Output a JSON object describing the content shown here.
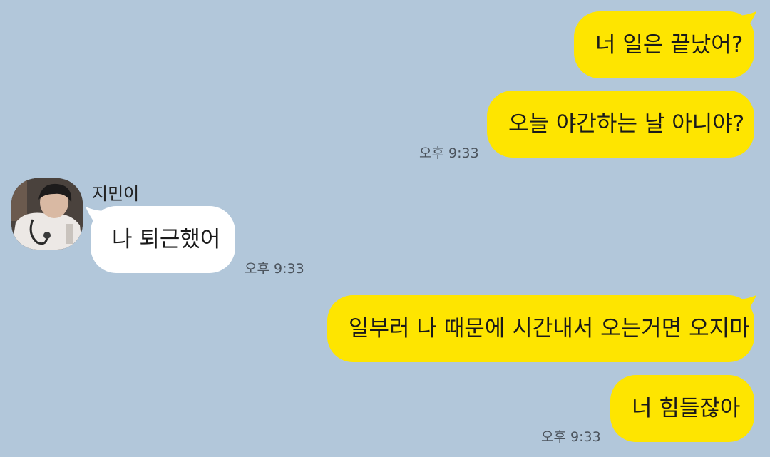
{
  "chat": {
    "sender_name": "지민이",
    "messages": [
      {
        "from": "me",
        "text": "너 일은 끝났어?"
      },
      {
        "from": "me",
        "text": "오늘 야간하는 날 아니야?",
        "time": "오후 9:33"
      },
      {
        "from": "other",
        "text": "나 퇴근했어",
        "time": "오후 9:33"
      },
      {
        "from": "me",
        "text": "일부러 나 때문에 시간내서 오는거면 오지마"
      },
      {
        "from": "me",
        "text": "너 힘들잖아",
        "time": "오후 9:33"
      }
    ]
  },
  "colors": {
    "background": "#b2c7da",
    "my_bubble": "#fee500",
    "other_bubble": "#ffffff"
  }
}
